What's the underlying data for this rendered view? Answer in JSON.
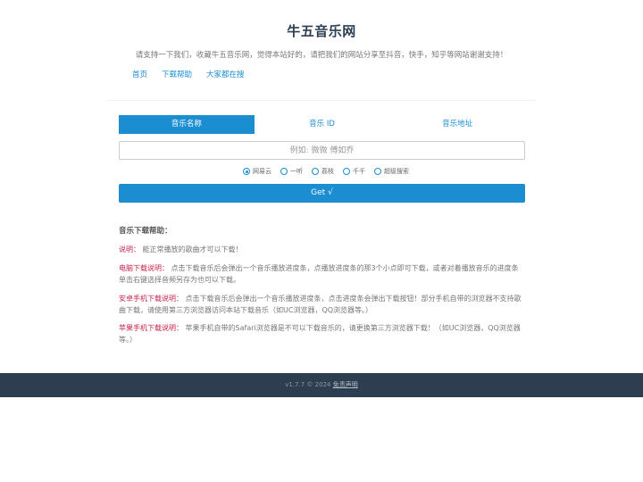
{
  "header": {
    "title": "牛五音乐网",
    "subtitle": "请支持一下我们，收藏牛五音乐网，觉得本站好的，请把我们的网站分享至抖音，快手，知乎等网站谢谢支持！",
    "nav": [
      "首页",
      "下载帮助",
      "大家都在搜"
    ]
  },
  "tabs": [
    "音乐名称",
    "音乐 ID",
    "音乐地址"
  ],
  "search": {
    "placeholder": "例如: 微微 傅如乔",
    "value": ""
  },
  "sources": [
    "网易云",
    "一听",
    "荔枝",
    "千千",
    "超级搜索"
  ],
  "selected_source": "网易云",
  "get_button": "Get √",
  "help": {
    "title": "音乐下载帮助：",
    "items": [
      {
        "label": "说明：",
        "text": "能正常播放的歌曲才可以下载！"
      },
      {
        "label": "电脑下载说明：",
        "text": "点击下载音乐后会弹出一个音乐播放进度条，点播放进度条的那3个小点即可下载，或者对着播放音乐的进度条单击右键选择音频另存为也可以下载。"
      },
      {
        "label": "安卓手机下载说明：",
        "text": "点击下载音乐后会弹出一个音乐播放进度条，点击进度条会弹出下载按钮！部分手机自带的浏览器不支持歌曲下载，请使用第三方浏览器访问本站下载音乐（如UC浏览器，QQ浏览器等。）"
      },
      {
        "label": "苹果手机下载说明：",
        "text": "苹果手机自带的Safari浏览器是不可以下载音乐的，请更换第三方浏览器下载！（如UC浏览器，QQ浏览器等。）"
      }
    ]
  },
  "footer": {
    "version": "v1.7.7 © 2024",
    "disclaimer": "免责声明"
  },
  "colors": {
    "accent": "#1b8dd1",
    "footer_bg": "#2c3e50",
    "highlight": "#c7254e"
  }
}
